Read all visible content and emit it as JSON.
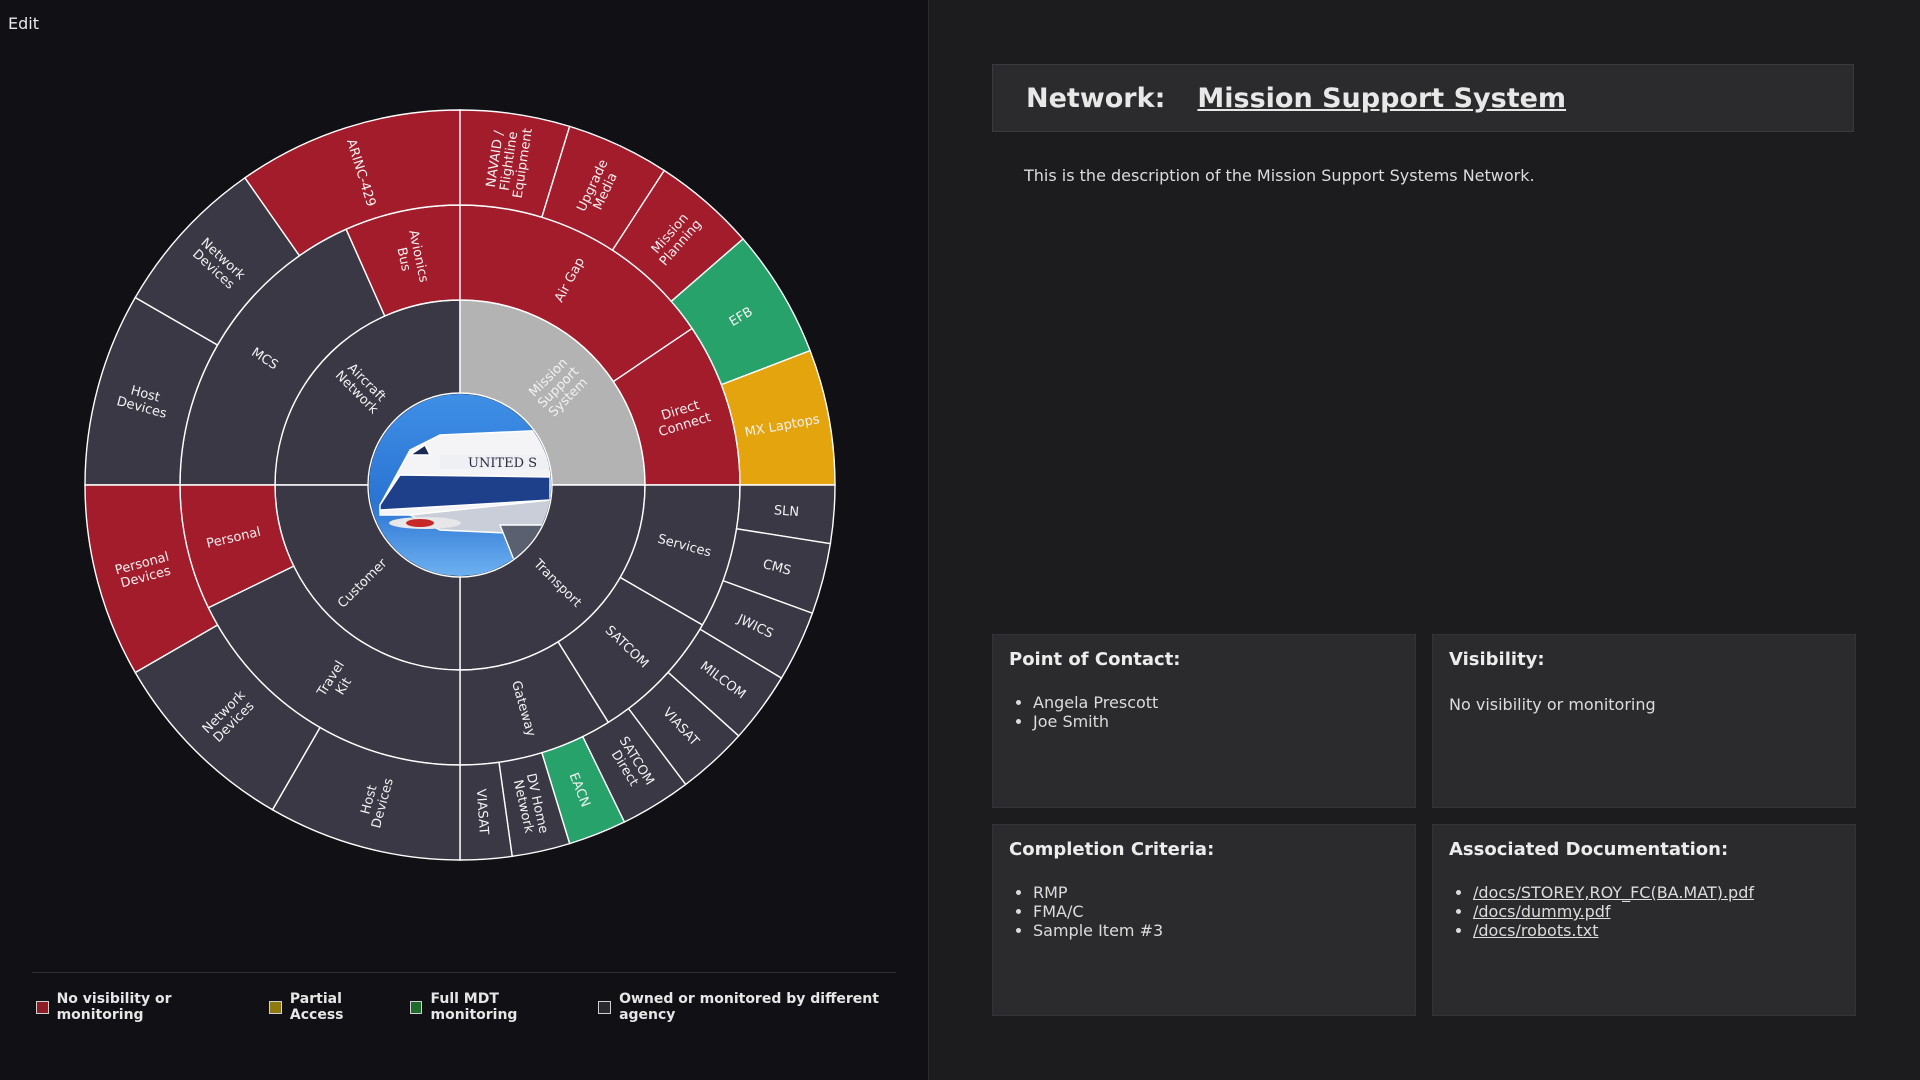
{
  "header": {
    "edit_label": "Edit"
  },
  "sunburst": {
    "colors": {
      "none": "#a31c2c",
      "partial": "#e4a40e",
      "full": "#27a26a",
      "other": "#3a3844",
      "selected": "#b3b3b3"
    },
    "center_image": "airplane-photo",
    "inner": [
      {
        "label": "Aircraft Network",
        "status": "other",
        "start": 270,
        "end": 360
      },
      {
        "label": "Mission Support System",
        "status": "selected",
        "start": 0,
        "end": 90
      },
      {
        "label": "Transport",
        "status": "other",
        "start": 90,
        "end": 180
      },
      {
        "label": "Customer",
        "status": "other",
        "start": 180,
        "end": 270
      }
    ],
    "middle": [
      {
        "label": "MCS",
        "status": "other",
        "start": 270,
        "end": 336
      },
      {
        "label": "Avionics Bus",
        "status": "none",
        "start": 336,
        "end": 360
      },
      {
        "label": "Air Gap",
        "status": "none",
        "start": 0,
        "end": 56
      },
      {
        "label": "Direct Connect",
        "status": "none",
        "start": 56,
        "end": 90
      },
      {
        "label": "Services",
        "status": "other",
        "start": 90,
        "end": 120
      },
      {
        "label": "SATCOM",
        "status": "other",
        "start": 120,
        "end": 148
      },
      {
        "label": "Gateway",
        "status": "other",
        "start": 148,
        "end": 180
      },
      {
        "label": "Travel Kit",
        "status": "other",
        "start": 180,
        "end": 244
      },
      {
        "label": "Personal",
        "status": "none",
        "start": 244,
        "end": 270
      }
    ],
    "outer": [
      {
        "label": "Host Devices",
        "status": "other",
        "start": 270,
        "end": 300
      },
      {
        "label": "Network Devices",
        "status": "other",
        "start": 300,
        "end": 325
      },
      {
        "label": "ARINC-429",
        "status": "none",
        "start": 325,
        "end": 360
      },
      {
        "label": "NAVAID / Flightline Equipment",
        "status": "none",
        "start": 0,
        "end": 17
      },
      {
        "label": "Upgrade Media",
        "status": "none",
        "start": 17,
        "end": 33
      },
      {
        "label": "Mission Planning",
        "status": "none",
        "start": 33,
        "end": 49
      },
      {
        "label": "EFB",
        "status": "full",
        "start": 49,
        "end": 69
      },
      {
        "label": "MX Laptops",
        "status": "partial",
        "start": 69,
        "end": 90
      },
      {
        "label": "SLN",
        "status": "other",
        "start": 90,
        "end": 99
      },
      {
        "label": "CMS",
        "status": "other",
        "start": 99,
        "end": 110
      },
      {
        "label": "JWICS",
        "status": "other",
        "start": 110,
        "end": 121
      },
      {
        "label": "MILCOM",
        "status": "other",
        "start": 121,
        "end": 132
      },
      {
        "label": "VIASAT",
        "status": "other",
        "start": 132,
        "end": 143
      },
      {
        "label": "SATCOM Direct",
        "status": "other",
        "start": 143,
        "end": 154
      },
      {
        "label": "EACN",
        "status": "full",
        "start": 154,
        "end": 163
      },
      {
        "label": "DV Home Network",
        "status": "other",
        "start": 163,
        "end": 172
      },
      {
        "label": "VIASAT",
        "status": "other",
        "start": 172,
        "end": 180
      },
      {
        "label": "Host Devices",
        "status": "other",
        "start": 180,
        "end": 210
      },
      {
        "label": "Network Devices",
        "status": "other",
        "start": 210,
        "end": 240
      },
      {
        "label": "Personal Devices",
        "status": "none",
        "start": 240,
        "end": 270
      }
    ]
  },
  "legend": {
    "items": [
      {
        "label": "No visibility or monitoring",
        "color": "#8f1b25"
      },
      {
        "label": "Partial Access",
        "color": "#8f7a10"
      },
      {
        "label": "Full MDT monitoring",
        "color": "#1e6b2c"
      },
      {
        "label": "Owned or monitored by different agency",
        "color": "#2a2a2e"
      }
    ]
  },
  "network": {
    "label": "Network:",
    "name": "Mission Support System",
    "description": "This is the description of the Mission Support Systems Network."
  },
  "cards": {
    "contact": {
      "title": "Point of Contact:",
      "items": [
        "Angela Prescott",
        "Joe Smith"
      ]
    },
    "visibility": {
      "title": "Visibility:",
      "value": "No visibility or monitoring"
    },
    "completion": {
      "title": "Completion Criteria:",
      "items": [
        "RMP",
        "FMA/C",
        "Sample Item #3"
      ]
    },
    "docs": {
      "title": "Associated Documentation:",
      "items": [
        "/docs/STOREY,ROY_FC(BA.MAT).pdf",
        "/docs/dummy.pdf",
        "/docs/robots.txt"
      ]
    }
  }
}
